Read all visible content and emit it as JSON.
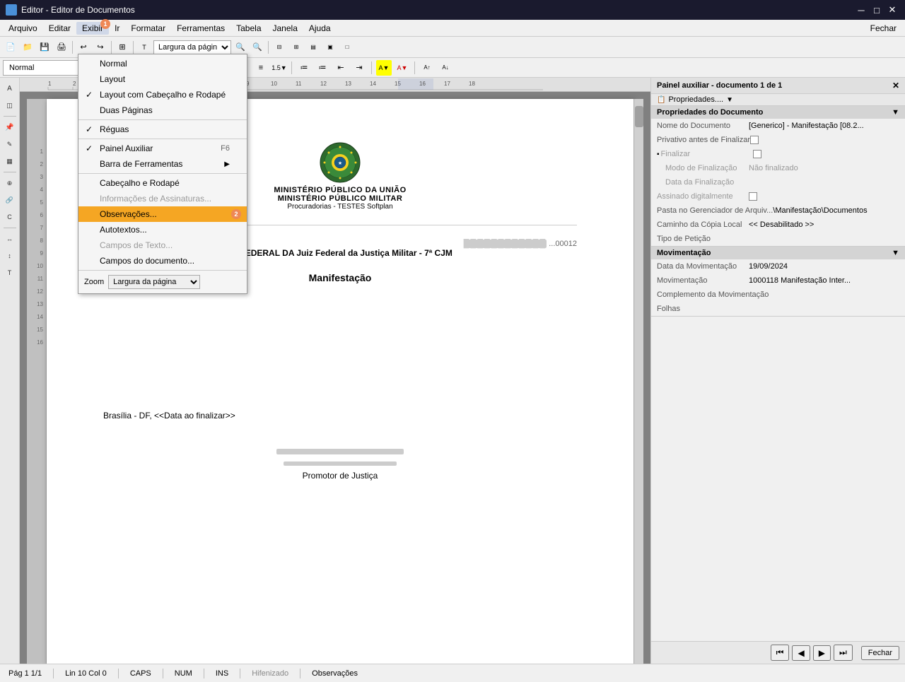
{
  "titleBar": {
    "title": "Editor - Editor de Documentos",
    "minimize": "─",
    "maximize": "□",
    "close": "✕"
  },
  "menuBar": {
    "items": [
      "Arquivo",
      "Editar",
      "Exibir",
      "Ir",
      "Formatar",
      "Ferramentas",
      "Tabela",
      "Janela",
      "Ajuda"
    ],
    "activeItem": "Exibir",
    "right": "Fechar"
  },
  "toolbar": {
    "zoomLabel": "Largura da págin",
    "styleLabel": "Normal"
  },
  "exibirMenu": {
    "items": [
      {
        "label": "Normal",
        "checked": false,
        "disabled": false,
        "shortcut": ""
      },
      {
        "label": "Layout",
        "checked": false,
        "disabled": false,
        "shortcut": ""
      },
      {
        "label": "Layout com Cabeçalho e Rodapé",
        "checked": true,
        "disabled": false,
        "shortcut": ""
      },
      {
        "label": "Duas Páginas",
        "checked": false,
        "disabled": false,
        "shortcut": ""
      },
      {
        "label": "Réguas",
        "checked": true,
        "disabled": false,
        "shortcut": ""
      },
      {
        "label": "Painel Auxiliar",
        "checked": true,
        "disabled": false,
        "shortcut": "F6"
      },
      {
        "label": "Barra de Ferramentas",
        "checked": false,
        "disabled": false,
        "shortcut": "▶",
        "hasSubmenu": true
      },
      {
        "label": "Cabeçalho e Rodapé",
        "checked": false,
        "disabled": false,
        "shortcut": ""
      },
      {
        "label": "Informações de Assinaturas...",
        "checked": false,
        "disabled": true,
        "shortcut": ""
      },
      {
        "label": "Observações...",
        "checked": false,
        "disabled": false,
        "shortcut": "",
        "highlighted": true
      },
      {
        "label": "Autotextos...",
        "checked": false,
        "disabled": false,
        "shortcut": ""
      },
      {
        "label": "Campos de Texto...",
        "checked": false,
        "disabled": true,
        "shortcut": ""
      },
      {
        "label": "Campos do documento...",
        "checked": false,
        "disabled": false,
        "shortcut": ""
      }
    ],
    "zoomSection": {
      "label": "Zoom",
      "value": "Largura da página"
    }
  },
  "sidePanel": {
    "title": "Painel auxiliar - documento 1 de 1",
    "sections": {
      "propriedades": {
        "title": "Propriedades do Documento",
        "fields": [
          {
            "label": "Nome do Documento",
            "value": "[Generico] - Manifestação [08.2..."
          },
          {
            "label": "Privativo antes de Finalizar",
            "value": "",
            "type": "checkbox"
          },
          {
            "label": "Finalizar",
            "value": "",
            "type": "checkbox",
            "disabled": true
          },
          {
            "label": "Modo de Finalização",
            "value": "Não finalizado",
            "disabled": true
          },
          {
            "label": "Data da Finalização",
            "value": "",
            "disabled": true
          },
          {
            "label": "Assinado digitalmente",
            "value": "",
            "type": "checkbox",
            "disabled": true
          },
          {
            "label": "Pasta no Gerenciador de Arquiv...",
            "value": "\\Manifestação\\Documentos"
          },
          {
            "label": "Caminho da Cópia Local",
            "value": "<< Desabilitado >>"
          },
          {
            "label": "Tipo de Petição",
            "value": ""
          }
        ]
      },
      "movimentacao": {
        "title": "Movimentação",
        "fields": [
          {
            "label": "Data da Movimentação",
            "value": "19/09/2024"
          },
          {
            "label": "Movimentação",
            "value": "1000118    Manifestação Inter..."
          },
          {
            "label": "Complemento da Movimentação",
            "value": ""
          },
          {
            "label": "Folhas",
            "value": ""
          }
        ]
      }
    },
    "bottomNav": {
      "first": "⏮",
      "prev": "◀",
      "next": "▶",
      "last": "⏭",
      "close": "Fechar"
    }
  },
  "document": {
    "ministry1": "MINISTÉRIO PÚBLICO DA UNIÃO",
    "ministry2": "MINISTÉRIO PÚBLICO MILITAR",
    "ministry3": "Procuradorias - TESTES Softplan",
    "salutation": "EXCELENTÍSSIMO SENHOR JUIZ FEDERAL DA Juiz Federal da Justiça Militar - 7ª CJM",
    "docTitle": "Manifestação",
    "date": "Brasília - DF, <<Data ao finalizar>>",
    "promotor": "Promotor de Justiça",
    "docNumber": "...00012"
  },
  "statusBar": {
    "page": "Pág 1  1/1",
    "position": "Lin 10 Col 0",
    "caps": "CAPS",
    "num": "NUM",
    "ins": "INS",
    "hifenizado": "Hifenizado",
    "observacoes": "Observações"
  }
}
